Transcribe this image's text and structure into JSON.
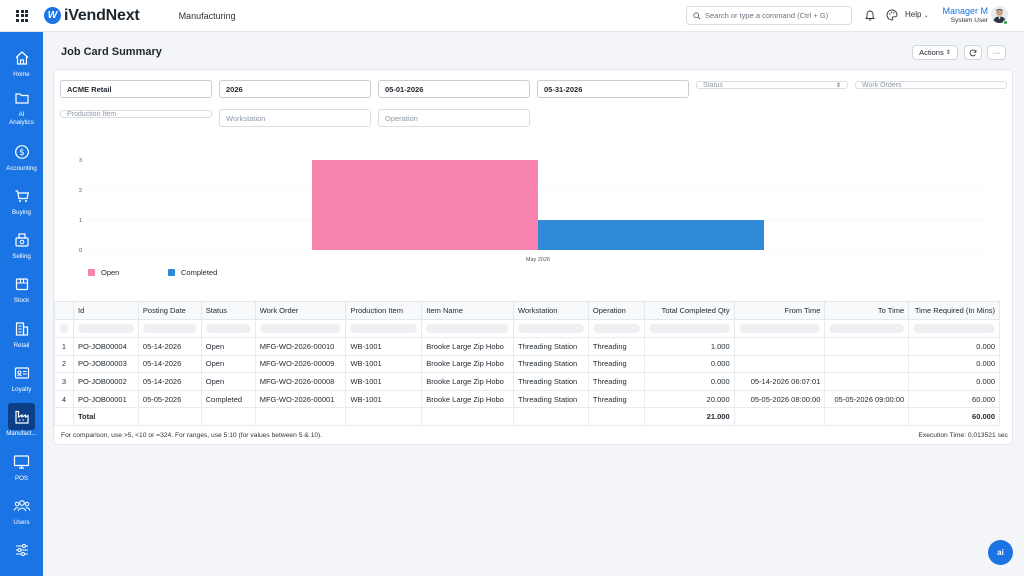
{
  "app": {
    "logo_text": "iVendNext",
    "module": "Manufacturing"
  },
  "search": {
    "placeholder": "Search or type a command (Ctrl + G)"
  },
  "help_label": "Help",
  "user": {
    "name": "Manager M",
    "role": "System User"
  },
  "sidebar": [
    {
      "label": "Home",
      "icon": "home-icon"
    },
    {
      "label": "AI Analytics",
      "icon": "folder-icon"
    },
    {
      "label": "Accounting",
      "icon": "dollar-icon"
    },
    {
      "label": "Buying",
      "icon": "cart-icon"
    },
    {
      "label": "Selling",
      "icon": "register-icon"
    },
    {
      "label": "Stock",
      "icon": "box-icon"
    },
    {
      "label": "Retail",
      "icon": "building-icon"
    },
    {
      "label": "Loyalty",
      "icon": "card-icon"
    },
    {
      "label": "Manufact...",
      "icon": "factory-icon"
    },
    {
      "label": "POS",
      "icon": "monitor-icon"
    },
    {
      "label": "Users",
      "icon": "users-icon"
    },
    {
      "label": "",
      "icon": "settings-sliders-icon"
    }
  ],
  "page": {
    "title": "Job Card Summary",
    "actions_label": "Actions",
    "more_label": "···"
  },
  "filters": {
    "company": "ACME Retail",
    "fiscal_year": "2026",
    "from_date": "05-01-2026",
    "to_date": "05-31-2026",
    "status_placeholder": "Status",
    "work_orders_placeholder": "Work Orders",
    "production_item_placeholder": "Production Item",
    "workstation_placeholder": "Workstation",
    "operation_placeholder": "Operation"
  },
  "chart_data": {
    "type": "bar",
    "categories": [
      "May 2026"
    ],
    "series": [
      {
        "name": "Open",
        "values": [
          3
        ],
        "color": "#f683ae"
      },
      {
        "name": "Completed",
        "values": [
          1
        ],
        "color": "#318ad8"
      }
    ],
    "yticks": [
      "0",
      "1",
      "2",
      "3"
    ],
    "ylim": [
      0,
      3
    ],
    "legend": "bottom-left"
  },
  "table": {
    "columns": [
      "Id",
      "Posting Date",
      "Status",
      "Work Order",
      "Production Item",
      "Item Name",
      "Workstation",
      "Operation",
      "Total Completed Qty",
      "From Time",
      "To Time",
      "Time Required (In Mins)"
    ],
    "rows": [
      {
        "n": "1",
        "id": "PO-JOB00004",
        "posting_date": "05-14-2026",
        "status": "Open",
        "work_order": "MFG-WO-2026-00010",
        "production_item": "WB-1001",
        "item_name": "Brooke Large Zip Hobo",
        "workstation": "Threading Station",
        "operation": "Threading",
        "qty": "1.000",
        "from_time": "",
        "to_time": "",
        "time_required": "0.000"
      },
      {
        "n": "2",
        "id": "PO-JOB00003",
        "posting_date": "05-14-2026",
        "status": "Open",
        "work_order": "MFG-WO-2026-00009",
        "production_item": "WB-1001",
        "item_name": "Brooke Large Zip Hobo",
        "workstation": "Threading Station",
        "operation": "Threading",
        "qty": "0.000",
        "from_time": "",
        "to_time": "",
        "time_required": "0.000"
      },
      {
        "n": "3",
        "id": "PO-JOB00002",
        "posting_date": "05-14-2026",
        "status": "Open",
        "work_order": "MFG-WO-2026-00008",
        "production_item": "WB-1001",
        "item_name": "Brooke Large Zip Hobo",
        "workstation": "Threading Station",
        "operation": "Threading",
        "qty": "0.000",
        "from_time": "05-14-2026 06:07:01",
        "to_time": "",
        "time_required": "0.000"
      },
      {
        "n": "4",
        "id": "PO-JOB00001",
        "posting_date": "05-05-2026",
        "status": "Completed",
        "work_order": "MFG-WO-2026-00001",
        "production_item": "WB-1001",
        "item_name": "Brooke Large Zip Hobo",
        "workstation": "Threading Station",
        "operation": "Threading",
        "qty": "20.000",
        "from_time": "05-05-2026 08:00:00",
        "to_time": "05-05-2026 09:00:00",
        "time_required": "60.000"
      }
    ],
    "total_label": "Total",
    "total_qty": "21.000",
    "total_time": "60.000"
  },
  "footnote": "For comparison, use >5, <10 or =324. For ranges, use 5:10 (for values between 5 & 10).",
  "execution_time": "Execution Time: 0.013521 sec",
  "ai_button": "ai",
  "colors": {
    "brand": "#1b74e4",
    "open": "#f683ae",
    "completed": "#318ad8"
  }
}
